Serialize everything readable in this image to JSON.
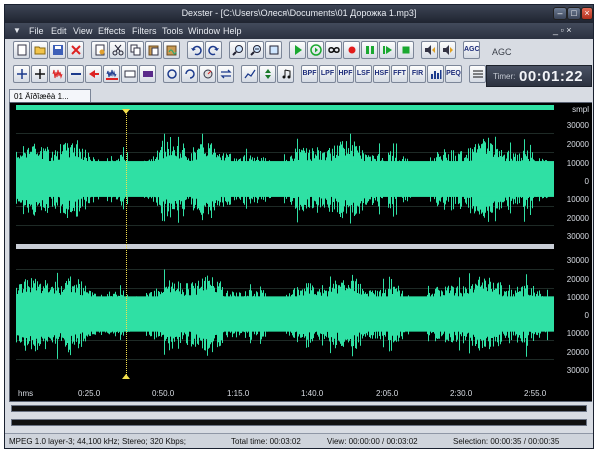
{
  "window": {
    "title": "Dexster - [C:\\Users\\Олеся\\Documents\\01 Дорожка 1.mp3]",
    "controls": {
      "minimize": "–",
      "maximize": "□",
      "close": "×"
    }
  },
  "menu": {
    "items": [
      "File",
      "Edit",
      "View",
      "Effects",
      "Filters",
      "Tools",
      "Window",
      "Help"
    ],
    "mdi_controls": "_ ▫ ×"
  },
  "toolbar1": {
    "buttons": [
      {
        "name": "new-file",
        "icon": "page-icon"
      },
      {
        "name": "open-file",
        "icon": "folder-icon"
      },
      {
        "name": "save-file",
        "icon": "floppy-icon"
      },
      {
        "name": "close-file",
        "icon": "red-x-icon"
      },
      {
        "name": "properties",
        "icon": "doc-icon"
      },
      {
        "name": "cut",
        "icon": "scissors-icon"
      },
      {
        "name": "copy",
        "icon": "copy-icon"
      },
      {
        "name": "paste",
        "icon": "paste-icon"
      },
      {
        "name": "mix-paste",
        "icon": "paste-mix-icon"
      },
      {
        "name": "undo",
        "icon": "undo-icon"
      },
      {
        "name": "redo",
        "icon": "redo-icon"
      },
      {
        "name": "zoom-in",
        "icon": "zoom-in-icon"
      },
      {
        "name": "zoom-out",
        "icon": "zoom-out-icon"
      },
      {
        "name": "zoom-full",
        "icon": "zoom-full-icon"
      },
      {
        "name": "play",
        "icon": "play-icon"
      },
      {
        "name": "play-loop",
        "icon": "play-loop-icon"
      },
      {
        "name": "loop",
        "icon": "infinity-icon"
      },
      {
        "name": "record",
        "icon": "record-icon"
      },
      {
        "name": "pause",
        "icon": "pause-icon"
      },
      {
        "name": "play-selection",
        "icon": "play-sel-icon"
      },
      {
        "name": "stop",
        "icon": "stop-icon"
      },
      {
        "name": "rewind",
        "icon": "rewind-speaker-icon"
      },
      {
        "name": "forward",
        "icon": "forward-speaker-icon"
      },
      {
        "name": "agc",
        "icon": "agc-icon",
        "label": "AGC"
      }
    ]
  },
  "toolbar2": {
    "buttons": [
      {
        "name": "fx-1",
        "icon": "cross-arrows-icon"
      },
      {
        "name": "fx-2",
        "icon": "cross-icon"
      },
      {
        "name": "fx-3",
        "icon": "wave-red-icon"
      },
      {
        "name": "fx-4",
        "icon": "flat-line-icon"
      },
      {
        "name": "fx-5",
        "icon": "red-arrow-icon"
      },
      {
        "name": "fx-6",
        "icon": "blue-wave-icon"
      },
      {
        "name": "fx-7",
        "icon": "abc-icon"
      },
      {
        "name": "fx-8",
        "icon": "block-icon"
      },
      {
        "name": "fx-9",
        "icon": "swirl-icon"
      },
      {
        "name": "fx-10",
        "icon": "loop-icon"
      },
      {
        "name": "fx-11",
        "icon": "dial-icon"
      },
      {
        "name": "fx-12",
        "icon": "swap-icon"
      },
      {
        "name": "fx-13",
        "icon": "chart-icon"
      },
      {
        "name": "fx-14",
        "icon": "up-down-icon"
      },
      {
        "name": "fx-15",
        "icon": "note-icon"
      },
      {
        "name": "bpf",
        "label": "BPF"
      },
      {
        "name": "lpf",
        "label": "LPF"
      },
      {
        "name": "hpf",
        "label": "HPF"
      },
      {
        "name": "lsf",
        "label": "LSF"
      },
      {
        "name": "hsf",
        "label": "HSF"
      },
      {
        "name": "fft",
        "label": "FFT"
      },
      {
        "name": "fir",
        "label": "FIR"
      },
      {
        "name": "fx-16",
        "icon": "eq-icon"
      },
      {
        "name": "peq",
        "label": "PEQ"
      },
      {
        "name": "fx-17",
        "icon": "settings-list-icon"
      }
    ]
  },
  "agc_label": "AGC",
  "timer": {
    "label": "Timer:",
    "value": "00:01:22"
  },
  "tab": {
    "label": "01 Äîðîæêà 1..."
  },
  "editor": {
    "unit": "smpl",
    "channel1_ticks": [
      "30000",
      "20000",
      "10000",
      "0",
      "10000",
      "20000",
      "30000"
    ],
    "channel2_ticks": [
      "30000",
      "20000",
      "10000",
      "0",
      "10000",
      "20000",
      "30000"
    ],
    "time_unit": "hms",
    "time_ticks": [
      "0:25.0",
      "0:50.0",
      "1:15.0",
      "1:40.0",
      "2:05.0",
      "2:30.0",
      "2:55.0"
    ],
    "wave_color": "#2fe0a4",
    "cursor_color": "#f4e04c"
  },
  "status": {
    "format": "MPEG 1.0 layer-3; 44,100 kHz; Stereo; 320 Kbps;",
    "total_time": "Total time: 00:03:02",
    "view": "View: 00:00:00 / 00:03:02",
    "selection": "Selection: 00:00:35 / 00:00:35"
  }
}
